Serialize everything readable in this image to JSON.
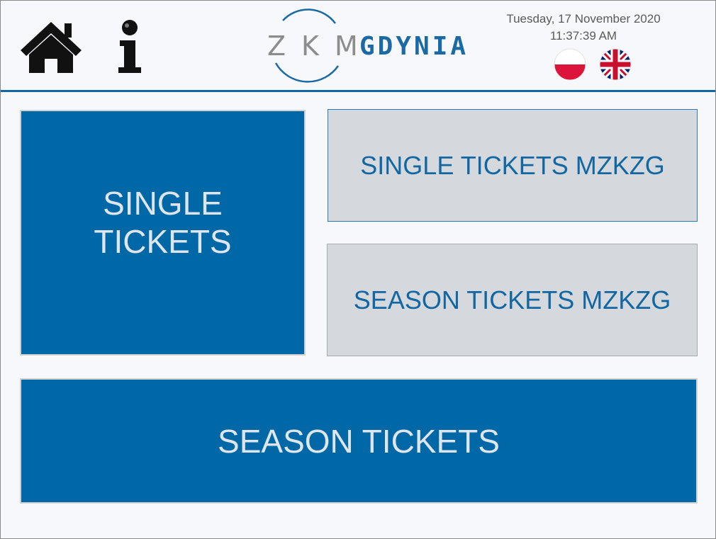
{
  "header": {
    "home_icon": "home-icon",
    "info_icon": "info-icon",
    "logo": {
      "part1": "ZKM",
      "part2": "GDYNIA"
    },
    "date": "Tuesday, 17 November 2020",
    "time": "11:37:39 AM",
    "languages": [
      {
        "code": "pl",
        "icon": "polish-flag-icon"
      },
      {
        "code": "en",
        "icon": "uk-flag-icon"
      }
    ]
  },
  "tiles": {
    "single_tickets": {
      "line1": "SINGLE",
      "line2": "TICKETS"
    },
    "single_tickets_mzkzg": "SINGLE TICKETS MZKZG",
    "season_tickets_mzkzg": "SEASON TICKETS MZKZG",
    "season_tickets": "SEASON TICKETS"
  },
  "colors": {
    "brand_blue": "#0068a6",
    "header_rule": "#1466a2",
    "grey_tile": "#d5d9de",
    "grey_tile_text": "#1267a3",
    "blue_tile_text": "#dfe5ec",
    "background": "#f7f8fc"
  }
}
